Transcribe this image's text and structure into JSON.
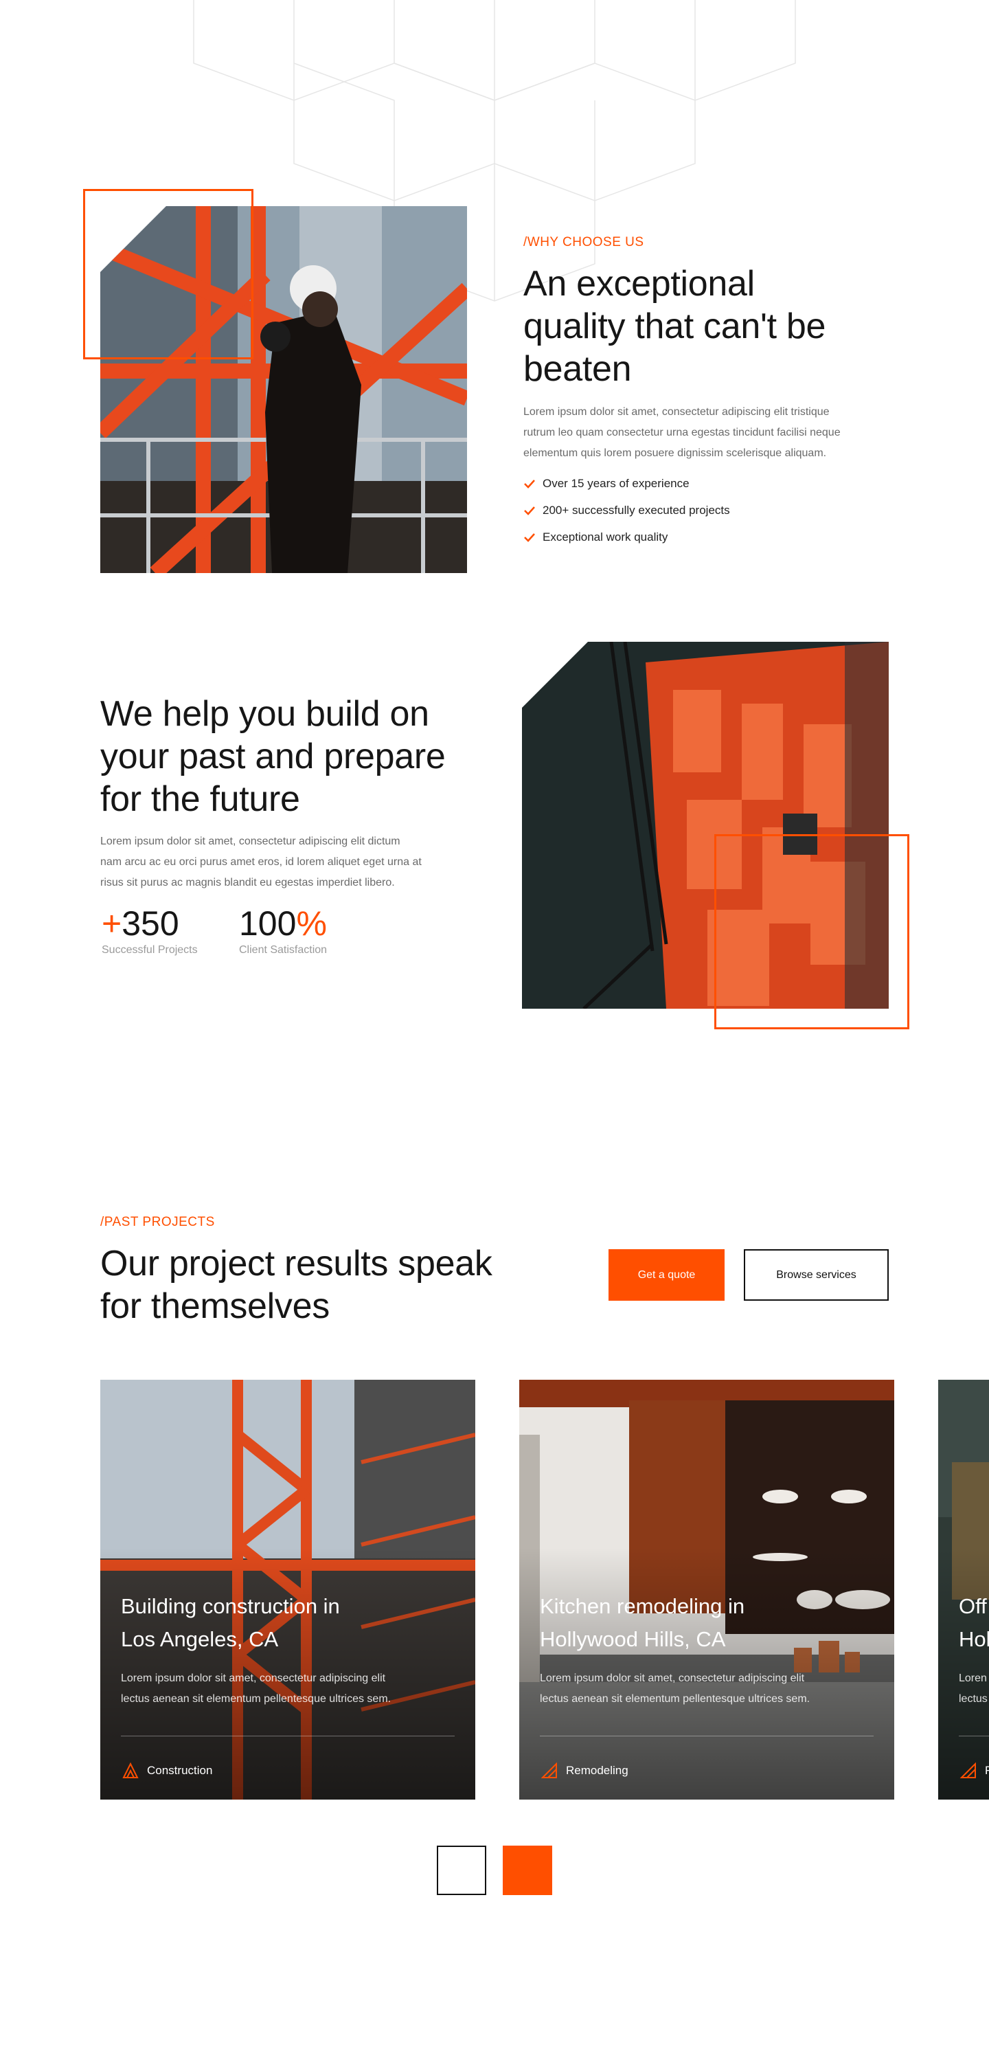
{
  "why_choose_us": {
    "eyebrow": "/WHY CHOOSE US",
    "heading_line1": "An exceptional",
    "heading_line2": "quality that can't be",
    "heading_line3": "beaten",
    "paragraph_line1": "Lorem ipsum dolor sit amet, consectetur adipiscing elit tristique",
    "paragraph_line2": "rutrum leo quam consectetur urna egestas tincidunt facilisi neque",
    "paragraph_line3": "elementum quis lorem posuere dignissim scelerisque aliquam.",
    "checklist": [
      {
        "label": "Over 15 years of experience",
        "icon": "check-icon"
      },
      {
        "label": "200+ successfully executed projects",
        "icon": "check-icon"
      },
      {
        "label": "Exceptional work quality",
        "icon": "check-icon"
      }
    ]
  },
  "build_section": {
    "heading_line1": "We help you build on",
    "heading_line2": "your past and prepare",
    "heading_line3": "for the future",
    "paragraph_line1": "Lorem ipsum dolor sit amet, consectetur adipiscing elit dictum",
    "paragraph_line2": "nam arcu ac eu orci purus amet eros, id lorem aliquet eget urna at",
    "paragraph_line3": "risus sit purus ac magnis blandit eu egestas imperdiet libero.",
    "stats": [
      {
        "prefix": "+",
        "value": "350",
        "suffix": "",
        "label": "Successful Projects"
      },
      {
        "prefix": "",
        "value": "100",
        "suffix": "%",
        "label": "Client Satisfaction"
      }
    ]
  },
  "past_projects": {
    "eyebrow": "/PAST PROJECTS",
    "heading_line1": "Our project results speak",
    "heading_line2": "for themselves",
    "primary_button": "Get a quote",
    "secondary_button": "Browse services",
    "cards": [
      {
        "title_line1": "Building construction in",
        "title_line2": "Los Angeles, CA",
        "desc_line1": "Lorem ipsum dolor sit amet, consectetur adipiscing elit",
        "desc_line2": "lectus aenean sit elementum pellentesque ultrices sem.",
        "tag": "Construction",
        "tag_icon": "construction-icon"
      },
      {
        "title_line1": "Kitchen remodeling in",
        "title_line2": "Hollywood Hills, CA",
        "desc_line1": "Lorem ipsum dolor sit amet, consectetur adipiscing elit",
        "desc_line2": "lectus aenean sit elementum pellentesque ultrices sem.",
        "tag": "Remodeling",
        "tag_icon": "ruler-triangle-icon"
      },
      {
        "title_line1": "Off",
        "title_line2": "Hol",
        "desc_line1": "Loren",
        "desc_line2": "lectus",
        "tag": "R",
        "tag_icon": "ruler-triangle-icon"
      }
    ],
    "slider_prev_icon": "arrow-left-icon",
    "slider_next_icon": "arrow-right-icon"
  },
  "colors": {
    "accent": "#ff4f00",
    "text_dark": "#161616",
    "text_muted": "#6a6a6a"
  }
}
